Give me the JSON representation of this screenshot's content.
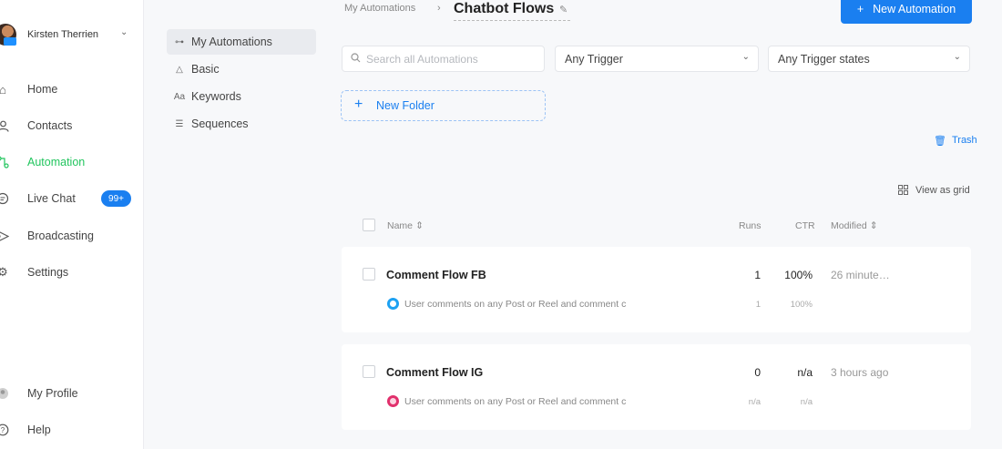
{
  "user": {
    "name": "Kirsten Therrien"
  },
  "nav": [
    {
      "label": "Home",
      "icon": "home-icon"
    },
    {
      "label": "Contacts",
      "icon": "user-icon"
    },
    {
      "label": "Automation",
      "icon": "automation-icon",
      "active": true
    },
    {
      "label": "Live Chat",
      "icon": "chat-icon",
      "badge": "99+"
    },
    {
      "label": "Broadcasting",
      "icon": "send-icon"
    },
    {
      "label": "Settings",
      "icon": "gear-icon"
    }
  ],
  "nav_bottom": [
    {
      "label": "My Profile",
      "icon": "profile-icon"
    },
    {
      "label": "Help",
      "icon": "help-icon"
    }
  ],
  "subnav": [
    {
      "label": "My Automations",
      "icon": "flows-icon",
      "active": true
    },
    {
      "label": "Basic",
      "icon": "triangle-icon"
    },
    {
      "label": "Keywords",
      "icon": "keywords-icon"
    },
    {
      "label": "Sequences",
      "icon": "sequences-icon"
    }
  ],
  "breadcrumb": {
    "parent": "My Automations",
    "sep": "›",
    "title": "Chatbot Flows"
  },
  "new_automation_label": "New Automation",
  "search": {
    "placeholder": "Search all Automations"
  },
  "filters": {
    "trigger": "Any Trigger",
    "trigger_states": "Any Trigger states"
  },
  "new_folder_label": "New Folder",
  "trash_label": "Trash",
  "view_grid_label": "View as grid",
  "table": {
    "headers": {
      "name": "Name",
      "runs": "Runs",
      "ctr": "CTR",
      "modified": "Modified"
    },
    "rows": [
      {
        "name": "Comment Flow FB",
        "runs": "1",
        "ctr": "100%",
        "modified": "26 minute…",
        "trigger": "User comments on any Post or Reel and comment c",
        "trigger_runs": "1",
        "trigger_ctr": "100%",
        "trigger_color": "#1da1f2"
      },
      {
        "name": "Comment Flow IG",
        "runs": "0",
        "ctr": "n/a",
        "modified": "3 hours ago",
        "trigger": "User comments on any Post or Reel and comment c",
        "trigger_runs": "n/a",
        "trigger_ctr": "n/a",
        "trigger_color": "#e1306c"
      }
    ]
  },
  "colors": {
    "accent": "#1a7ff0",
    "active_nav": "#22c55e"
  }
}
